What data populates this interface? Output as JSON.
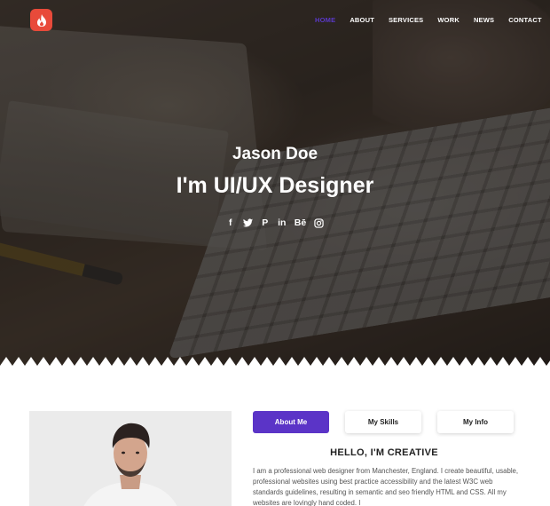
{
  "brand": {
    "logo_icon": "flame-icon",
    "logo_color": "#e84a3a"
  },
  "nav": {
    "items": [
      {
        "label": "HOME",
        "active": true
      },
      {
        "label": "ABOUT",
        "active": false
      },
      {
        "label": "SERVICES",
        "active": false
      },
      {
        "label": "WORK",
        "active": false
      },
      {
        "label": "NEWS",
        "active": false
      },
      {
        "label": "CONTACT",
        "active": false
      }
    ],
    "active_color": "#5a38c8"
  },
  "hero": {
    "name": "Jason Doe",
    "role": "I'm UI/UX Designer",
    "socials": [
      {
        "icon": "facebook-icon",
        "glyph": "f"
      },
      {
        "icon": "twitter-icon",
        "glyph": "🐦"
      },
      {
        "icon": "pinterest-icon",
        "glyph": "P"
      },
      {
        "icon": "linkedin-icon",
        "glyph": "in"
      },
      {
        "icon": "behance-icon",
        "glyph": "Bē"
      },
      {
        "icon": "instagram-icon",
        "glyph": "◎"
      }
    ]
  },
  "about": {
    "tabs": [
      {
        "label": "About Me",
        "active": true
      },
      {
        "label": "My Skills",
        "active": false
      },
      {
        "label": "My Info",
        "active": false
      }
    ],
    "title": "HELLO, I'M CREATIVE",
    "text": "I am a professional web designer from Manchester, England. I create beautiful, usable, professional websites using best practice accessibility and the latest W3C web standards guidelines, resulting in semantic and seo friendly HTML and CSS. All my websites are lovingly hand coded. I",
    "accent": "#5b34c7"
  }
}
